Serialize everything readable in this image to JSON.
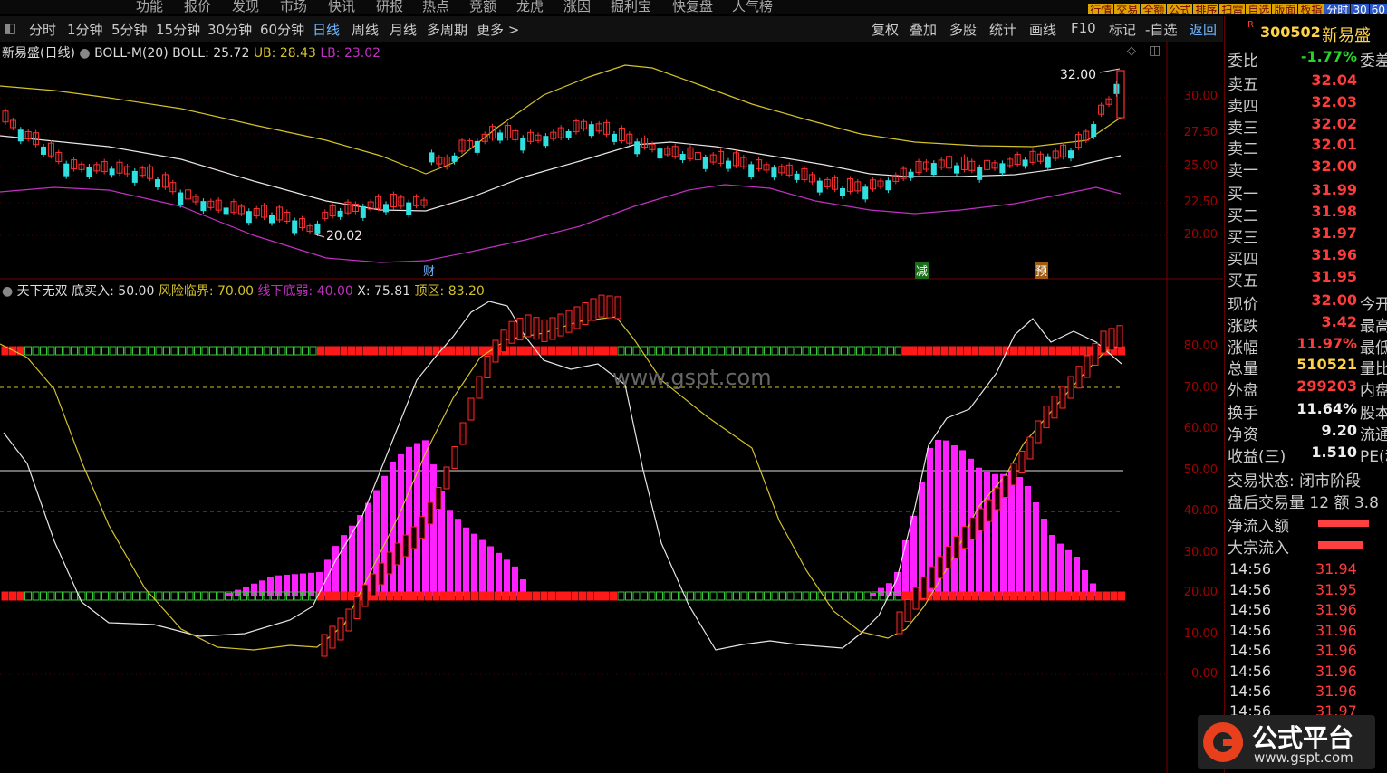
{
  "topmenu": [
    "功能",
    "报价",
    "发现",
    "市场",
    "快讯",
    "研报",
    "热点",
    "竞额",
    "龙虎",
    "涨因",
    "掘利宝",
    "快复盘",
    "人气榜"
  ],
  "right_buttons": [
    "行情",
    "交易",
    "全额",
    "公式",
    "排序",
    "扫雷",
    "自选",
    "版面",
    "板指",
    "分时",
    "30",
    "60"
  ],
  "toolbar": {
    "left": [
      "分时",
      "1分钟",
      "5分钟",
      "15分钟",
      "30分钟",
      "60分钟",
      "日线",
      "周线",
      "月线",
      "多周期",
      "更多 >"
    ],
    "active": "日线",
    "right": [
      "复权",
      "叠加",
      "多股",
      "统计",
      "画线",
      "F10",
      "标记",
      "-自选",
      "返回"
    ]
  },
  "main_chart": {
    "stock": "新易盛(日线)",
    "indicator": "BOLL-M(20)",
    "boll_label": "BOLL: 25.72",
    "ub_label": "UB: 28.43",
    "lb_label": "LB: 23.02",
    "high_mark": "32.00",
    "low_mark": "20.02",
    "event_labels": [
      "财",
      "减",
      "预"
    ],
    "yticks": [
      "30.00",
      "27.50",
      "25.00",
      "22.50",
      "20.00"
    ],
    "colors": {
      "boll": "#e6e6e6",
      "ub": "#d4c22a",
      "lb": "#c030c0",
      "up": "#ff3030",
      "down": "#30e0e0"
    }
  },
  "sub_chart": {
    "name": "天下无双",
    "buy_label": "底买入: 50.00",
    "risk_label": "风险临界: 70.00",
    "weak_label": "线下底弱: 40.00",
    "x_label": "X: 75.81",
    "top_label": "顶区: 83.20",
    "yticks": [
      "80.00",
      "70.00",
      "60.00",
      "50.00",
      "40.00",
      "30.00",
      "20.00",
      "10.00",
      "0.00"
    ],
    "watermark": "www.gspt.com"
  },
  "sidebar": {
    "code": "300502",
    "name": "新易盛",
    "webi_label": "委比",
    "webi_value": "-1.77%",
    "webi_ext": "委差",
    "asks": [
      {
        "label": "卖五",
        "price": "32.04"
      },
      {
        "label": "卖四",
        "price": "32.03"
      },
      {
        "label": "卖三",
        "price": "32.02"
      },
      {
        "label": "卖二",
        "price": "32.01"
      },
      {
        "label": "卖一",
        "price": "32.00"
      }
    ],
    "bids": [
      {
        "label": "买一",
        "price": "31.99"
      },
      {
        "label": "买二",
        "price": "31.98"
      },
      {
        "label": "买三",
        "price": "31.97"
      },
      {
        "label": "买四",
        "price": "31.96"
      },
      {
        "label": "买五",
        "price": "31.95"
      }
    ],
    "stats": [
      {
        "label": "现价",
        "value": "32.00",
        "ext": "今开"
      },
      {
        "label": "涨跌",
        "value": "3.42",
        "ext": "最高"
      },
      {
        "label": "涨幅",
        "value": "11.97%",
        "ext": "最低"
      },
      {
        "label": "总量",
        "value": "510521",
        "ext": "量比"
      },
      {
        "label": "外盘",
        "value": "299203",
        "ext": "内盘"
      },
      {
        "label": "换手",
        "value": "11.64%",
        "ext": "股本"
      },
      {
        "label": "净资",
        "value": "9.20",
        "ext": "流通"
      },
      {
        "label": "收益(三)",
        "value": "1.510",
        "ext": "PE(动"
      }
    ],
    "trade_status": "交易状态: 闭市阶段",
    "after_hours": "盘后交易量 12 额 3.8",
    "net_inflow": "净流入额",
    "block_inflow": "大宗流入",
    "ticks": [
      {
        "time": "14:56",
        "price": "31.94"
      },
      {
        "time": "14:56",
        "price": "31.95"
      },
      {
        "time": "14:56",
        "price": "31.96"
      },
      {
        "time": "14:56",
        "price": "31.96"
      },
      {
        "time": "14:56",
        "price": "31.96"
      },
      {
        "time": "14:56",
        "price": "31.96"
      },
      {
        "time": "14:56",
        "price": "31.96"
      },
      {
        "time": "14:56",
        "price": "31.97"
      }
    ]
  },
  "logo": {
    "title": "公式平台",
    "url": "www.gspt.com"
  }
}
